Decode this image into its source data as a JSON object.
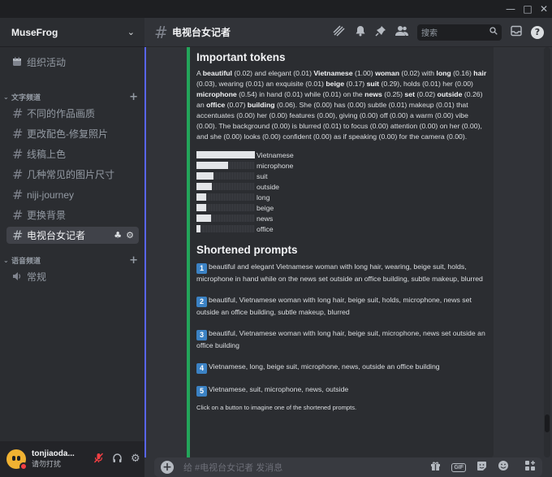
{
  "window": {
    "minimize": "—",
    "maximize": "□",
    "close": "✕"
  },
  "server": {
    "name": "MuseFrog",
    "chevron": "⌄"
  },
  "sidebar": {
    "events_label": "组织活动",
    "text_category": "文字频道",
    "voice_category": "语音频道",
    "text_channels": [
      "不同的作品画质",
      "更改配色-修复照片",
      "线稿上色",
      "几种常见的图片尺寸",
      "niji-journey",
      "更换背景",
      "电视台女记者"
    ],
    "active_index": 6,
    "voice_channels": [
      "常规"
    ]
  },
  "user": {
    "name": "tonjiaoda...",
    "status": "请勿打扰",
    "status_color": "#f23f43"
  },
  "header": {
    "channel_name": "电视台女记者",
    "search_placeholder": "搜索"
  },
  "embed": {
    "title_tokens": "Important tokens",
    "title_shortened": "Shortened prompts",
    "accent_color": "#23a55a",
    "footer_note": "Click on a button to imagine one of the shortened prompts."
  },
  "token_paragraph": [
    {
      "t": "A ",
      "b": false
    },
    {
      "t": "beautiful",
      "b": true
    },
    {
      "t": " (0.02) and elegant (0.01) ",
      "b": false
    },
    {
      "t": "Vietnamese",
      "b": true
    },
    {
      "t": " (1.00) ",
      "b": false
    },
    {
      "t": "woman",
      "b": true
    },
    {
      "t": " (0.02) with ",
      "b": false
    },
    {
      "t": "long",
      "b": true
    },
    {
      "t": " (0.16) ",
      "b": false
    },
    {
      "t": "hair",
      "b": true
    },
    {
      "t": " (0.03), wearing (0.01) an exquisite (0.01) ",
      "b": false
    },
    {
      "t": "beige",
      "b": true
    },
    {
      "t": " (0.17) ",
      "b": false
    },
    {
      "t": "suit",
      "b": true
    },
    {
      "t": " (0.29), holds (0.01) her (0.00) ",
      "b": false
    },
    {
      "t": "microphone",
      "b": true
    },
    {
      "t": " (0.54) in hand (0.01) while (0.01) on the ",
      "b": false
    },
    {
      "t": "news",
      "b": true
    },
    {
      "t": " (0.25) ",
      "b": false
    },
    {
      "t": "set",
      "b": true
    },
    {
      "t": " (0.02) ",
      "b": false
    },
    {
      "t": "outside",
      "b": true
    },
    {
      "t": " (0.26) an ",
      "b": false
    },
    {
      "t": "office",
      "b": true
    },
    {
      "t": " (0.07) ",
      "b": false
    },
    {
      "t": "building",
      "b": true
    },
    {
      "t": " (0.06). She (0.00) has (0.00) subtle (0.01) makeup (0.01) that accentuates (0.00) her (0.00) features (0.00), giving (0.00) off (0.00) a warm (0.00) vibe (0.00). The background (0.00) is blurred (0.01) to focus (0.00) attention (0.00) on her (0.00), and she (0.00) looks (0.00) confident (0.00) as if speaking (0.00) for the camera (0.00).",
      "b": false
    }
  ],
  "token_bars": [
    {
      "label": "Vietnamese",
      "value": 1.0
    },
    {
      "label": "microphone",
      "value": 0.54
    },
    {
      "label": "suit",
      "value": 0.29
    },
    {
      "label": "outside",
      "value": 0.26
    },
    {
      "label": "long",
      "value": 0.16
    },
    {
      "label": "beige",
      "value": 0.17
    },
    {
      "label": "news",
      "value": 0.25
    },
    {
      "label": "office",
      "value": 0.07
    }
  ],
  "prompts": [
    {
      "num": "1",
      "text": "beautiful and elegant Vietnamese woman with long hair, wearing, beige suit, holds, microphone in hand while on the news set outside an office building, subtle makeup, blurred"
    },
    {
      "num": "2",
      "text": "beautiful, Vietnamese woman with long hair, beige suit, holds, microphone, news set outside an office building, subtle makeup, blurred"
    },
    {
      "num": "3",
      "text": "beautiful, Vietnamese woman with long hair, beige suit, microphone, news set outside an office building"
    },
    {
      "num": "4",
      "text": "Vietnamese, long, beige suit, microphone, news, outside an office building"
    },
    {
      "num": "5",
      "text": "Vietnamese, suit, microphone, news, outside"
    }
  ],
  "composer": {
    "placeholder": "给 #电视台女记者 发消息",
    "gif_label": "GIF"
  }
}
